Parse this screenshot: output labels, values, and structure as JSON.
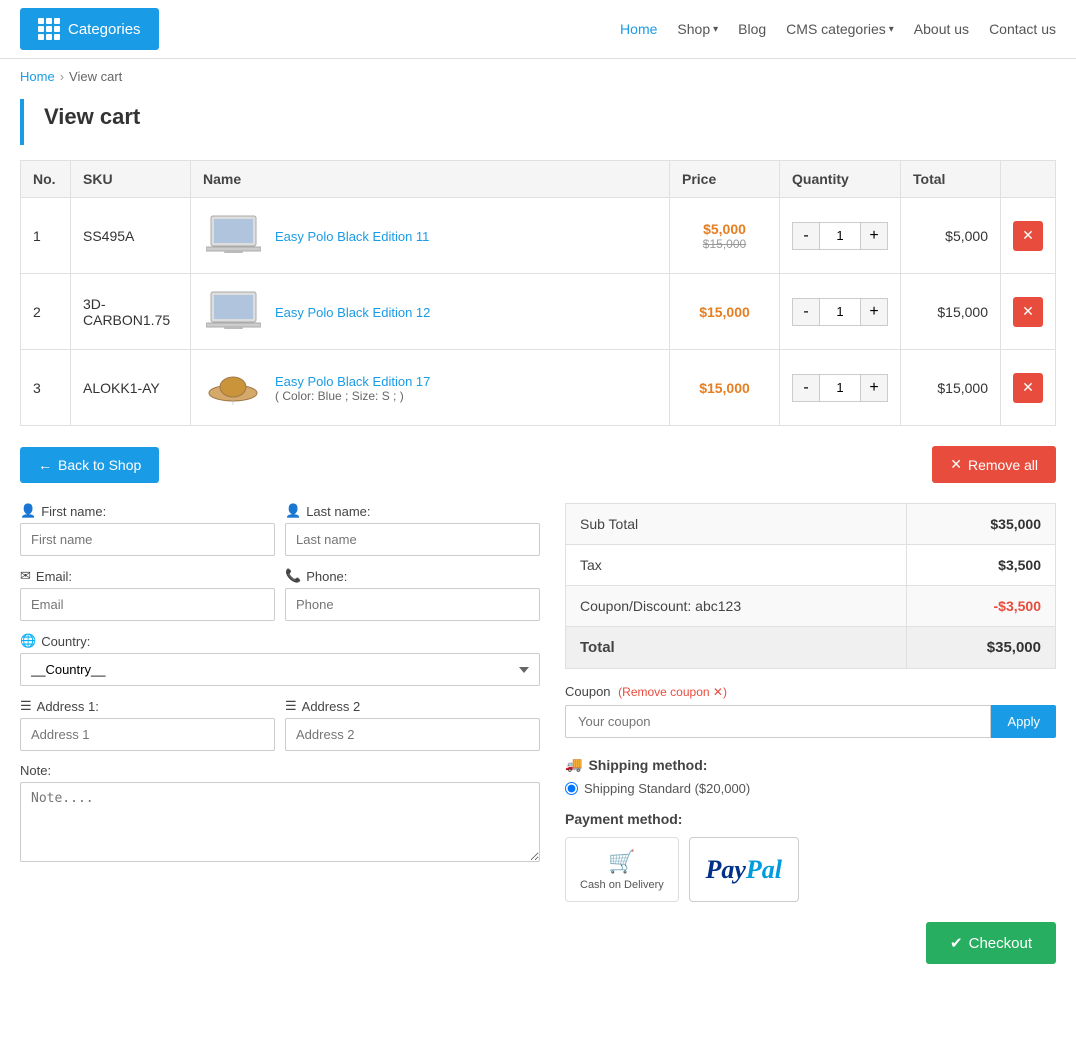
{
  "header": {
    "categories_label": "Categories",
    "nav": [
      {
        "label": "Home",
        "active": true
      },
      {
        "label": "Shop",
        "dropdown": true
      },
      {
        "label": "Blog",
        "dropdown": false
      },
      {
        "label": "CMS categories",
        "dropdown": true
      },
      {
        "label": "About us",
        "dropdown": false
      },
      {
        "label": "Contact us",
        "dropdown": false
      }
    ]
  },
  "breadcrumb": {
    "home": "Home",
    "current": "View cart"
  },
  "page_title": "View cart",
  "table": {
    "headers": [
      "No.",
      "SKU",
      "Name",
      "Price",
      "Quantity",
      "Total",
      ""
    ],
    "rows": [
      {
        "no": "1",
        "sku": "SS495A",
        "name": "Easy Polo Black Edition 11",
        "price": "$5,000",
        "price_original": "$15,000",
        "qty": "1",
        "total": "$5,000",
        "variant": ""
      },
      {
        "no": "2",
        "sku": "3D-CARBON1.75",
        "name": "Easy Polo Black Edition 12",
        "price": "$15,000",
        "price_original": "",
        "qty": "1",
        "total": "$15,000",
        "variant": ""
      },
      {
        "no": "3",
        "sku": "ALOKK1-AY",
        "name": "Easy Polo Black Edition 17",
        "price": "$15,000",
        "price_original": "",
        "qty": "1",
        "total": "$15,000",
        "variant": "( Color: Blue ; Size: S ; )"
      }
    ]
  },
  "actions": {
    "back_to_shop": "Back to Shop",
    "remove_all": "Remove all"
  },
  "form": {
    "first_name_label": "First name:",
    "first_name_placeholder": "First name",
    "last_name_label": "Last name:",
    "last_name_placeholder": "Last name",
    "email_label": "Email:",
    "email_placeholder": "Email",
    "phone_label": "Phone:",
    "phone_placeholder": "Phone",
    "country_label": "Country:",
    "country_placeholder": "__Country__",
    "address1_label": "Address 1:",
    "address1_placeholder": "Address 1",
    "address2_label": "Address 2",
    "address2_placeholder": "Address 2",
    "note_label": "Note:",
    "note_placeholder": "Note...."
  },
  "summary": {
    "subtotal_label": "Sub Total",
    "subtotal_value": "$35,000",
    "tax_label": "Tax",
    "tax_value": "$3,500",
    "coupon_label": "Coupon/Discount: abc123",
    "coupon_value": "-$3,500",
    "total_label": "Total",
    "total_value": "$35,000"
  },
  "coupon": {
    "label": "Coupon",
    "remove_coupon": "(Remove coupon ✕)",
    "placeholder": "Your coupon",
    "apply_label": "Apply"
  },
  "shipping": {
    "title": "Shipping method:",
    "option": "Shipping Standard ($20,000)"
  },
  "payment": {
    "title": "Payment method:",
    "cod_label": "Cash on Delivery",
    "paypal_label": "PayPal"
  },
  "checkout": {
    "label": "Checkout"
  }
}
